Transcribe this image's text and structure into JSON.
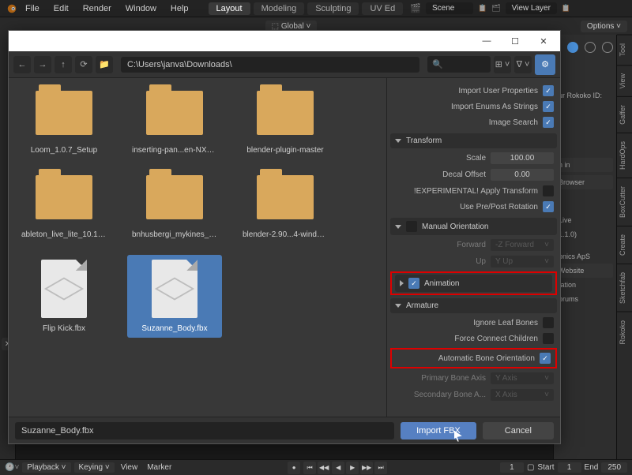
{
  "topbar": {
    "menus": [
      "File",
      "Edit",
      "Render",
      "Window",
      "Help"
    ],
    "tabs": [
      "Layout",
      "Modeling",
      "Sculpting",
      "UV Ed"
    ],
    "scene_label": "Scene",
    "viewlayer_label": "View Layer"
  },
  "toolbar2": {
    "global": "Global",
    "options": "Options"
  },
  "right_tabs": [
    "Tool",
    "View",
    "Gaffer",
    "HardOps",
    "BoxCutter",
    "Create",
    "Sketchfab",
    "Rokoko"
  ],
  "right_panel": {
    "rokoko_id": "ur Rokoko ID:",
    "sign_in": "n in",
    "browser": "Browser",
    "live": "Live",
    "version": "1.1.0)",
    "onics": "onics ApS",
    "website": "Website",
    "tation": "tation",
    "orums": "orums"
  },
  "dialog": {
    "path": "C:\\Users\\janva\\Downloads\\",
    "filename": "Suzanne_Body.fbx",
    "import_btn": "Import FBX",
    "cancel_btn": "Cancel",
    "folders": [
      "Loom_1.0.7_Setup",
      "inserting-pan...en-NXT763A",
      "blender-plugin-master",
      "ableton_live_lite_10.1.15_64",
      "bnhusbergi_mykines_froyar",
      "blender-2.90...4-windows64"
    ],
    "files": [
      {
        "name": "Flip Kick.fbx",
        "selected": false
      },
      {
        "name": "Suzanne_Body.fbx",
        "selected": true
      }
    ]
  },
  "props": {
    "import_user_properties": "Import User Properties",
    "import_enums": "Import Enums As Strings",
    "image_search": "Image Search",
    "transform_header": "Transform",
    "scale_label": "Scale",
    "scale_value": "100.00",
    "decal_label": "Decal Offset",
    "decal_value": "0.00",
    "experimental": "!EXPERIMENTAL! Apply Transform",
    "prepost": "Use Pre/Post Rotation",
    "manual_orient": "Manual Orientation",
    "forward_label": "Forward",
    "forward_value": "-Z Forward",
    "up_label": "Up",
    "up_value": "Y Up",
    "animation": "Animation",
    "armature": "Armature",
    "ignore_leaf": "Ignore Leaf Bones",
    "force_connect": "Force Connect Children",
    "auto_bone": "Automatic Bone Orientation",
    "primary_axis_label": "Primary Bone Axis",
    "primary_axis_value": "Y Axis",
    "secondary_axis_label": "Secondary Bone A...",
    "secondary_axis_value": "X Axis"
  },
  "timeline": {
    "playback": "Playback",
    "keying": "Keying",
    "view": "View",
    "marker": "Marker",
    "frame": "1",
    "start_label": "Start",
    "start_value": "1",
    "end_label": "End",
    "end_value": "250"
  }
}
